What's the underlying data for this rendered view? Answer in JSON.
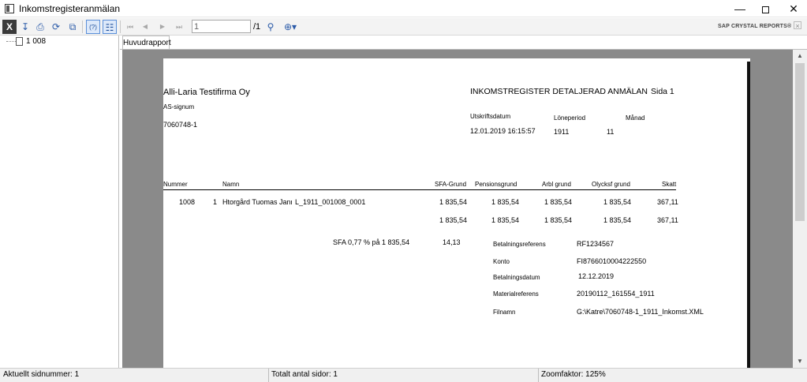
{
  "window": {
    "title": "Inkomstregisteranmälan",
    "min_glyph": "—",
    "close_glyph": "✕"
  },
  "toolbar": {
    "close_label": "X",
    "page_input_value": "1",
    "page_total": "/1",
    "brand": "SAP CRYSTAL REPORTS®",
    "brand_close": "×",
    "icons": {
      "export": "↧",
      "print": "⎙",
      "refresh": "⟳",
      "copy": "⧉",
      "help": "(?)",
      "tree": "☷",
      "first": "⏮",
      "prev": "◀",
      "next": "▶",
      "last": "⏭",
      "find": "⚲",
      "zoom": "⊕▾"
    }
  },
  "tree": {
    "root_label": "1 008"
  },
  "tabs": [
    {
      "label": "Huvudrapport"
    }
  ],
  "report": {
    "company": "Alli-Laria Testifirma Oy",
    "as_signum": "AS-signum",
    "org_number": "7060748-1",
    "title": "INKOMSTREGISTER DETALJERAD ANMÄLAN",
    "page_label": "Sida 1",
    "print_date_label": "Utskriftsdatum",
    "print_date": "12.01.2019 16:15:57",
    "period_label": "Löneperiod",
    "period": "1911",
    "month_label": "Månad",
    "month": "11",
    "columns": [
      "Nummer",
      "Namn",
      "SFA-Grund",
      "Pensionsgrund",
      "Arbl grund",
      "Olycksf grund",
      "Skatt"
    ],
    "row": {
      "number": "1008",
      "seq": "1",
      "name": "Htorgård Tuomas Janne",
      "ref": "L_1911_001008_0001",
      "sfa": "1 835,54",
      "pension": "1 835,54",
      "arbl": "1 835,54",
      "olycksf": "1 835,54",
      "skatt": "367,11"
    },
    "totals": {
      "sfa": "1 835,54",
      "pension": "1 835,54",
      "arbl": "1 835,54",
      "olycksf": "1 835,54",
      "skatt": "367,11"
    },
    "sfa_note": "SFA 0,77 % på 1 835,54",
    "sfa_amount": "14,13",
    "payment": {
      "ref_label": "Betalningsreferens",
      "ref": "RF1234567",
      "account_label": "Konto",
      "account": "FI8766010004222550",
      "date_label": "Betalningsdatum",
      "date": "12.12.2019",
      "material_label": "Materialreferens",
      "material": "20190112_161554_1911",
      "file_label": "Filnamn",
      "file": "G:\\Katre\\7060748-1_1911_Inkomst.XML"
    }
  },
  "statusbar": {
    "current_page": "Aktuellt sidnummer: 1",
    "total_pages": "Totalt antal sidor: 1",
    "zoom": "Zoomfaktor: 125%"
  }
}
